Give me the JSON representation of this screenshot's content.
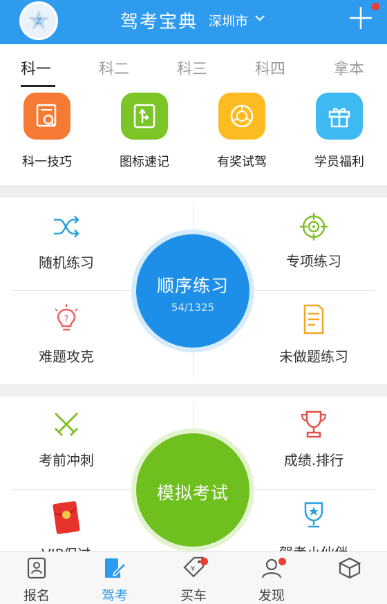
{
  "header": {
    "app_title": "驾考宝典",
    "city": "深圳市"
  },
  "subject_tabs": [
    {
      "label": "科一",
      "active": true
    },
    {
      "label": "科二",
      "active": false
    },
    {
      "label": "科三",
      "active": false
    },
    {
      "label": "科四",
      "active": false
    },
    {
      "label": "拿本",
      "active": false
    }
  ],
  "quick_entries": [
    {
      "label": "科一技巧",
      "icon": "certificate-search-icon",
      "color": "#f67a33"
    },
    {
      "label": "图标速记",
      "icon": "road-sign-icon",
      "color": "#7bc526"
    },
    {
      "label": "有奖试驾",
      "icon": "steering-wheel-icon",
      "color": "#fdbb22"
    },
    {
      "label": "学员福利",
      "icon": "gift-icon",
      "color": "#3fb9f2"
    }
  ],
  "practice": {
    "center_title": "顺序练习",
    "center_progress": "54/1325",
    "items": [
      {
        "label": "随机练习",
        "icon": "shuffle-icon"
      },
      {
        "label": "专项练习",
        "icon": "target-icon"
      },
      {
        "label": "难题攻克",
        "icon": "lightbulb-icon"
      },
      {
        "label": "未做题练习",
        "icon": "document-icon"
      }
    ]
  },
  "exam": {
    "center_title": "模拟考试",
    "items": [
      {
        "label": "考前冲刺",
        "icon": "crossed-swords-icon"
      },
      {
        "label": "成绩.排行",
        "icon": "trophy-icon"
      },
      {
        "label": "VIP保过",
        "icon": "red-envelope-icon"
      },
      {
        "label": "驾考小伙伴",
        "icon": "medal-cup-icon"
      }
    ]
  },
  "tabbar": [
    {
      "label": "报名",
      "icon": "id-card-icon",
      "active": false,
      "dot": false
    },
    {
      "label": "驾考",
      "icon": "edit-icon",
      "active": true,
      "dot": false
    },
    {
      "label": "买车",
      "icon": "price-tag-icon",
      "active": false,
      "dot": true
    },
    {
      "label": "发现",
      "icon": "user-icon",
      "active": false,
      "dot": true
    },
    {
      "label": "",
      "icon": "box-icon",
      "active": false,
      "dot": false
    }
  ],
  "colors": {
    "header_blue": "#2e9bef",
    "practice_blue": "#1d8fe8",
    "exam_green": "#6fbf1e",
    "badge_red": "#f13b2f"
  }
}
